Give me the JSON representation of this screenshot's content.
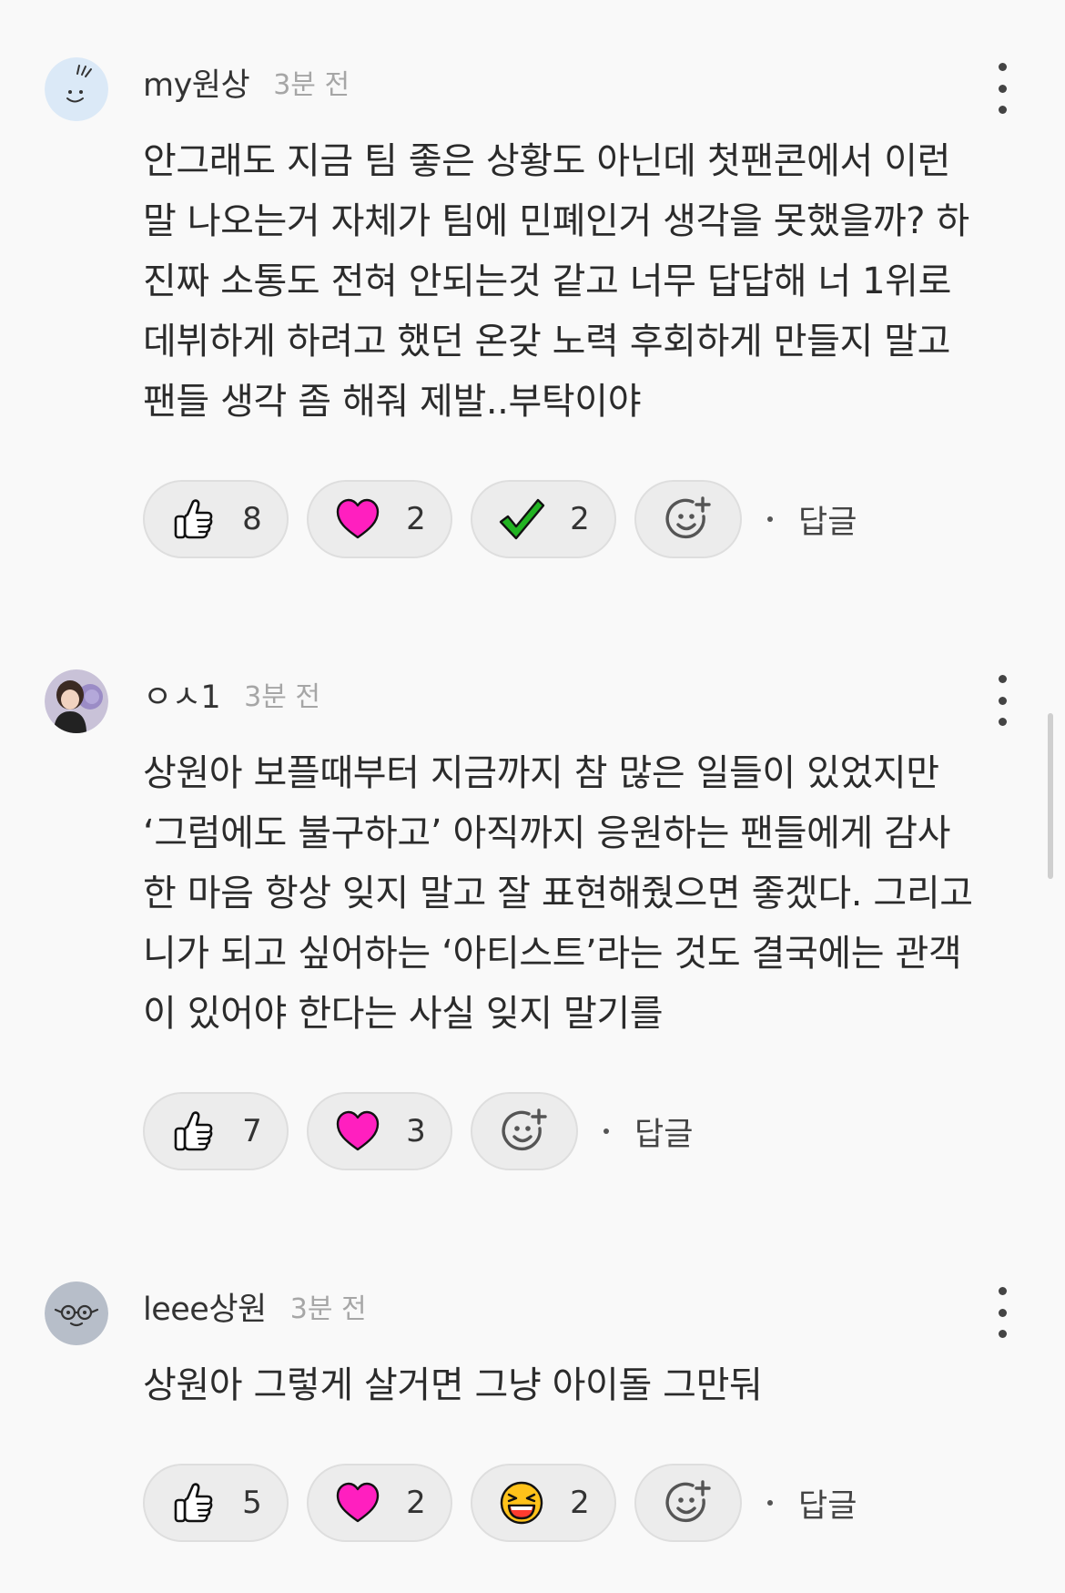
{
  "comments": [
    {
      "username": "my원상",
      "time": "3분 전",
      "lines": [
        "안그래도 지금 팀 좋은 상황도 아닌데 첫팬콘에서 이런",
        "말 나오는거 자체가 팀에 민폐인거 생각을 못했을까? 하",
        "진짜 소통도 전혀 안되는것 같고 너무 답답해 너 1위로",
        "데뷔하게 하려고 했던 온갖 노력 후회하게 만들지 말고",
        "팬들 생각 좀 해줘 제발..부탁이야"
      ],
      "reactions": [
        {
          "icon": "thumbs-up-icon",
          "count": "8"
        },
        {
          "icon": "heart-icon",
          "count": "2",
          "color": "#ff1fbf"
        },
        {
          "icon": "check-icon",
          "count": "2",
          "color": "#22b322"
        }
      ],
      "reply_label": "답글"
    },
    {
      "username": "ㅇㅅ1",
      "time": "3분 전",
      "lines": [
        "상원아 보플때부터 지금까지 참 많은 일들이 있었지만",
        "‘그럼에도 불구하고’ 아직까지 응원하는 팬들에게 감사",
        "한 마음 항상 잊지 말고 잘 표현해줬으면 좋겠다. 그리고",
        "니가 되고 싶어하는 ‘아티스트’라는 것도 결국에는 관객",
        "이 있어야 한다는 사실 잊지 말기를"
      ],
      "reactions": [
        {
          "icon": "thumbs-up-icon",
          "count": "7"
        },
        {
          "icon": "heart-icon",
          "count": "3",
          "color": "#ff1fbf"
        }
      ],
      "reply_label": "답글"
    },
    {
      "username": "leee상원",
      "time": "3분 전",
      "lines": [
        "상원아 그렇게 살거면 그냥 아이돌 그만둬"
      ],
      "reactions": [
        {
          "icon": "thumbs-up-icon",
          "count": "5"
        },
        {
          "icon": "heart-icon",
          "count": "2",
          "color": "#ff1fbf"
        },
        {
          "icon": "laughing-face-icon",
          "count": "2",
          "color": "#ffc21a"
        }
      ],
      "reply_label": "답글"
    }
  ]
}
